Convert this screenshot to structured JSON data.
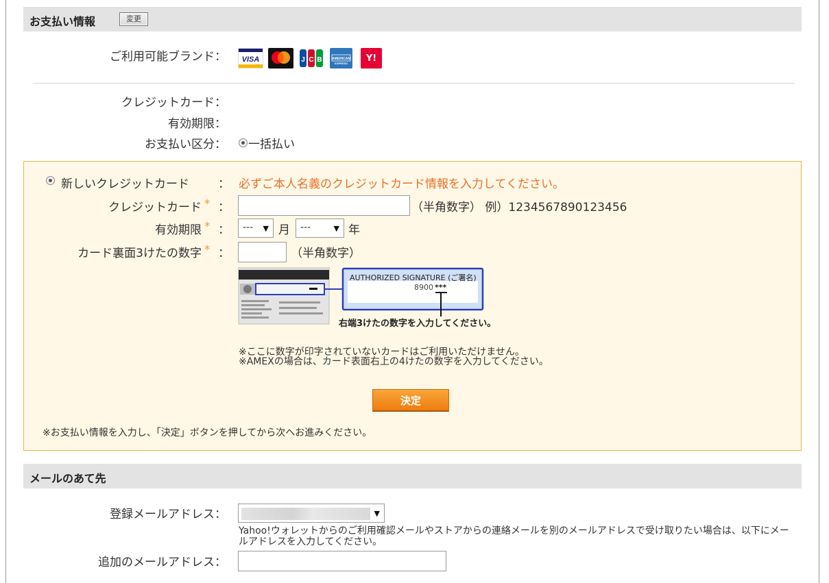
{
  "payment": {
    "title": "お支払い情報",
    "change_label": "変更",
    "brands_label": "ご利用可能ブランド：",
    "brands": [
      "VISA",
      "Mastercard",
      "JCB",
      "AMERICAN EXPRESS",
      "Y!"
    ],
    "credit_card_label": "クレジットカード：",
    "expiry_label": "有効期限：",
    "payment_type_label": "お支払い区分：",
    "payment_type_value": "一括払い"
  },
  "new_card": {
    "option_label": "新しいクレジットカード",
    "colon": "：",
    "notice": "必ずご本人名義のクレジットカード情報を入力してください。",
    "required_mark": "*",
    "card_number_label": "クレジットカード",
    "card_number_hint": "（半角数字） 例）1234567890123456",
    "expiry_label": "有効期限",
    "month_value": "---",
    "month_unit": "月",
    "year_value": "---",
    "year_unit": "年",
    "cvv_label": "カード裏面3けたの数字",
    "cvv_hint": "（半角数字）",
    "sig_title": "AUTHORIZED SIGNATURE (ご署名)",
    "sig_number": "8900",
    "sig_stars": "***",
    "sig_caption": "右端3けたの数字を入力してください。",
    "note1": "※ここに数字が印字されていないカードはご利用いただけません。",
    "note2": "※AMEXの場合は、カード表面右上の4けたの数字を入力してください。",
    "submit_label": "決定",
    "footer_note": "※お支払い情報を入力し、「決定」ボタンを押してから次へお進みください。"
  },
  "mail": {
    "title": "メールのあて先",
    "registered_label": "登録メールアドレス：",
    "registered_help": "Yahoo!ウォレットからのご利用確認メールやストアからの連絡メールを別のメールアドレスで受け取りたい場合は、以下にメールアドレスを入力してください。",
    "additional_label": "追加のメールアドレス："
  },
  "colors": {
    "notice": "#e8702a",
    "required": "#f39a3a",
    "panel_bg": "#fff8e6",
    "panel_border": "#e6b54a",
    "button": "#ee7d0e"
  }
}
